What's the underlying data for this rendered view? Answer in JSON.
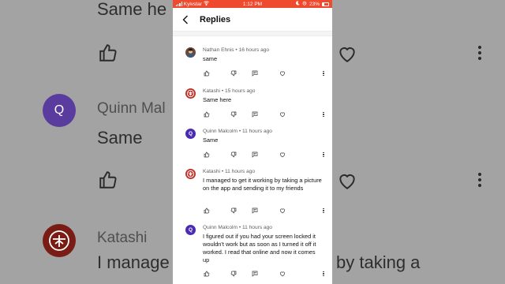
{
  "status_bar": {
    "carrier": "Kyivstar",
    "time": "1:12 PM",
    "battery": "23%",
    "color": "#f04a2e"
  },
  "header": {
    "title": "Replies",
    "back_icon": "chevron-left-icon"
  },
  "replies": [
    {
      "author": "Nathan Ehnis",
      "age": "16 hours ago",
      "text": "same",
      "avatar_color": "#6b4a3a",
      "avatar_letter": ""
    },
    {
      "author": "Katashi",
      "age": "15 hours ago",
      "text": "Same here",
      "avatar_color": "#c0322a",
      "avatar_letter": ""
    },
    {
      "author": "Quinn Malcolm",
      "age": "11 hours ago",
      "text": "Same",
      "avatar_color": "#4b2bb3",
      "avatar_letter": "Q"
    },
    {
      "author": "Katashi",
      "age": "11 hours ago",
      "text": "I managed to get it working by taking a picture on the app and sending it to my friends",
      "avatar_color": "#c0322a",
      "avatar_letter": ""
    },
    {
      "author": "Quinn Malcolm",
      "age": "11 hours ago",
      "text": "I figured out if you had your screen locked it wouldn't work but as soon as I turned it off it worked. I read that online and now it comes up",
      "avatar_color": "#4b2bb3",
      "avatar_letter": "Q"
    }
  ],
  "background": {
    "top_text": "Same he",
    "name1": "Quinn Mal",
    "text1": "Same",
    "name2": "Katashi",
    "text2_left": "I manage",
    "text2_right": "by taking a",
    "avatar_letter": "Q",
    "avatar_color": "#5a3b9e"
  }
}
